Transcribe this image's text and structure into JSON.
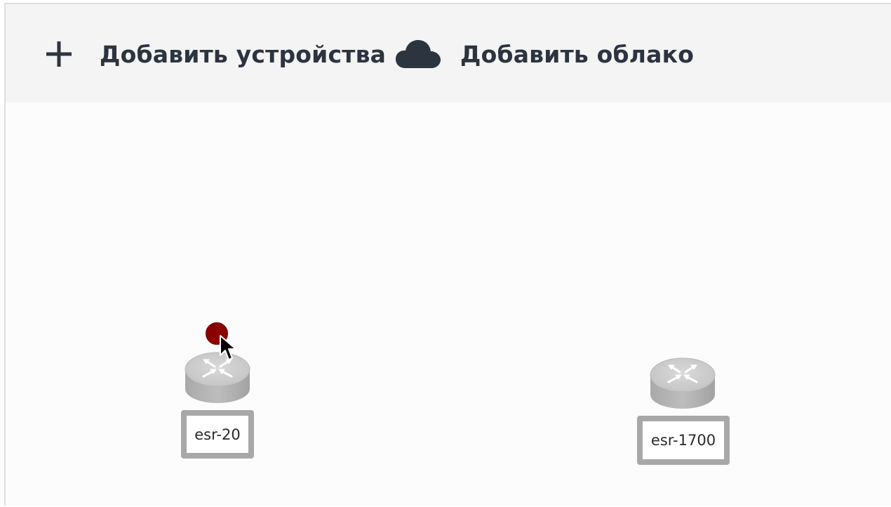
{
  "toolbar": {
    "add_devices": {
      "icon": "plus-icon",
      "label": "Добавить устройства"
    },
    "add_cloud": {
      "icon": "cloud-icon",
      "label": "Добавить облако"
    }
  },
  "devices": [
    {
      "name": "esr-20",
      "icon": "router-icon",
      "status": "error",
      "status_color": "#8b0000"
    },
    {
      "name": "esr-1700",
      "icon": "router-icon"
    }
  ],
  "colors": {
    "toolbar_bg": "#f4f4f4",
    "canvas_bg": "#fcfcfc",
    "text": "#2c3440",
    "label_border": "#a8a8a8"
  }
}
